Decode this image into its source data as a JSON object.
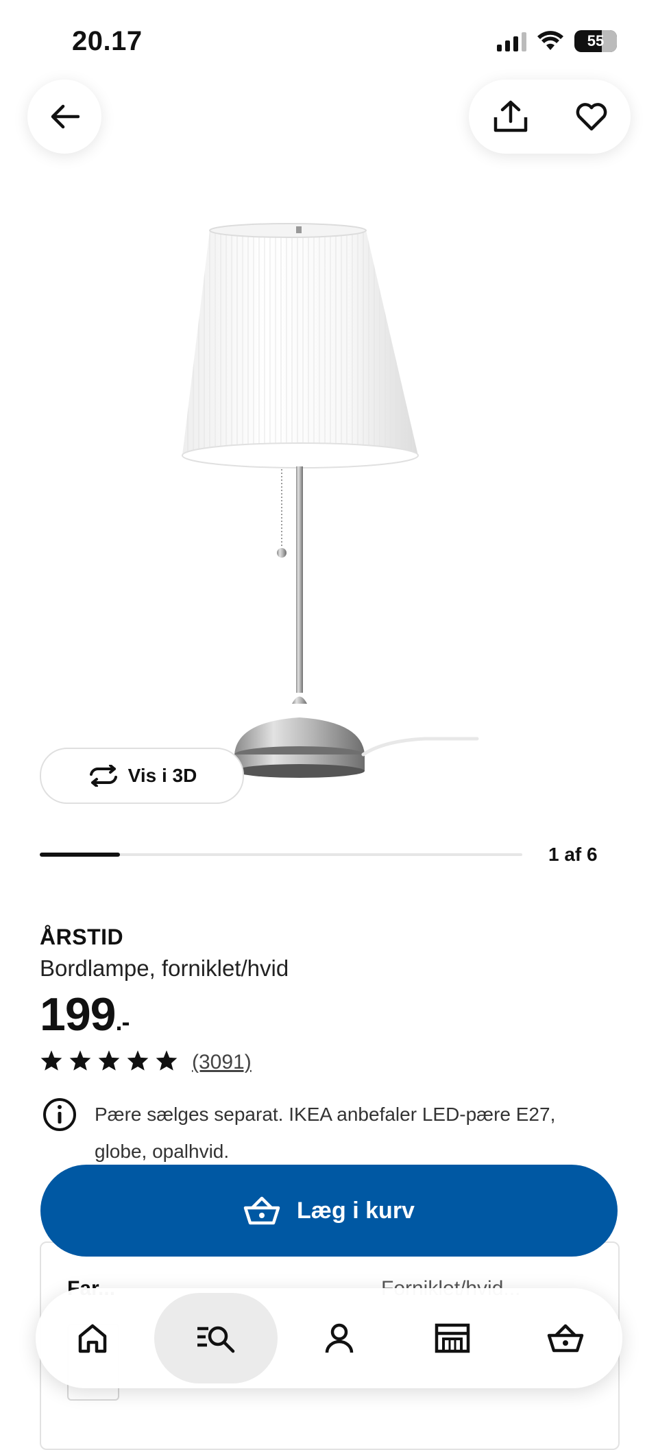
{
  "status_bar": {
    "time": "20.17",
    "battery": "55"
  },
  "carousel": {
    "view3d_label": "Vis i 3D",
    "page_counter": "1 af 6",
    "current": 1,
    "total": 6
  },
  "product": {
    "name": "ÅRSTID",
    "description": "Bordlampe, forniklet/hvid",
    "price": "199",
    "price_suffix": ".-",
    "rating": 5,
    "review_count": "(3091)",
    "notice": "Pære sælges separat. IKEA anbefaler LED-pære E27, globe, opalhvid."
  },
  "cta": {
    "add_to_cart_label": "Læg i kurv"
  },
  "hidden_section": {
    "label": "Far...",
    "value": "Forniklet/hvid..."
  },
  "nav": {
    "items": [
      {
        "icon": "home-icon",
        "active": false
      },
      {
        "icon": "search-list-icon",
        "active": true
      },
      {
        "icon": "profile-icon",
        "active": false
      },
      {
        "icon": "store-icon",
        "active": false
      },
      {
        "icon": "basket-icon",
        "active": false
      }
    ]
  },
  "colors": {
    "accent": "#0058a3",
    "text": "#111111"
  }
}
